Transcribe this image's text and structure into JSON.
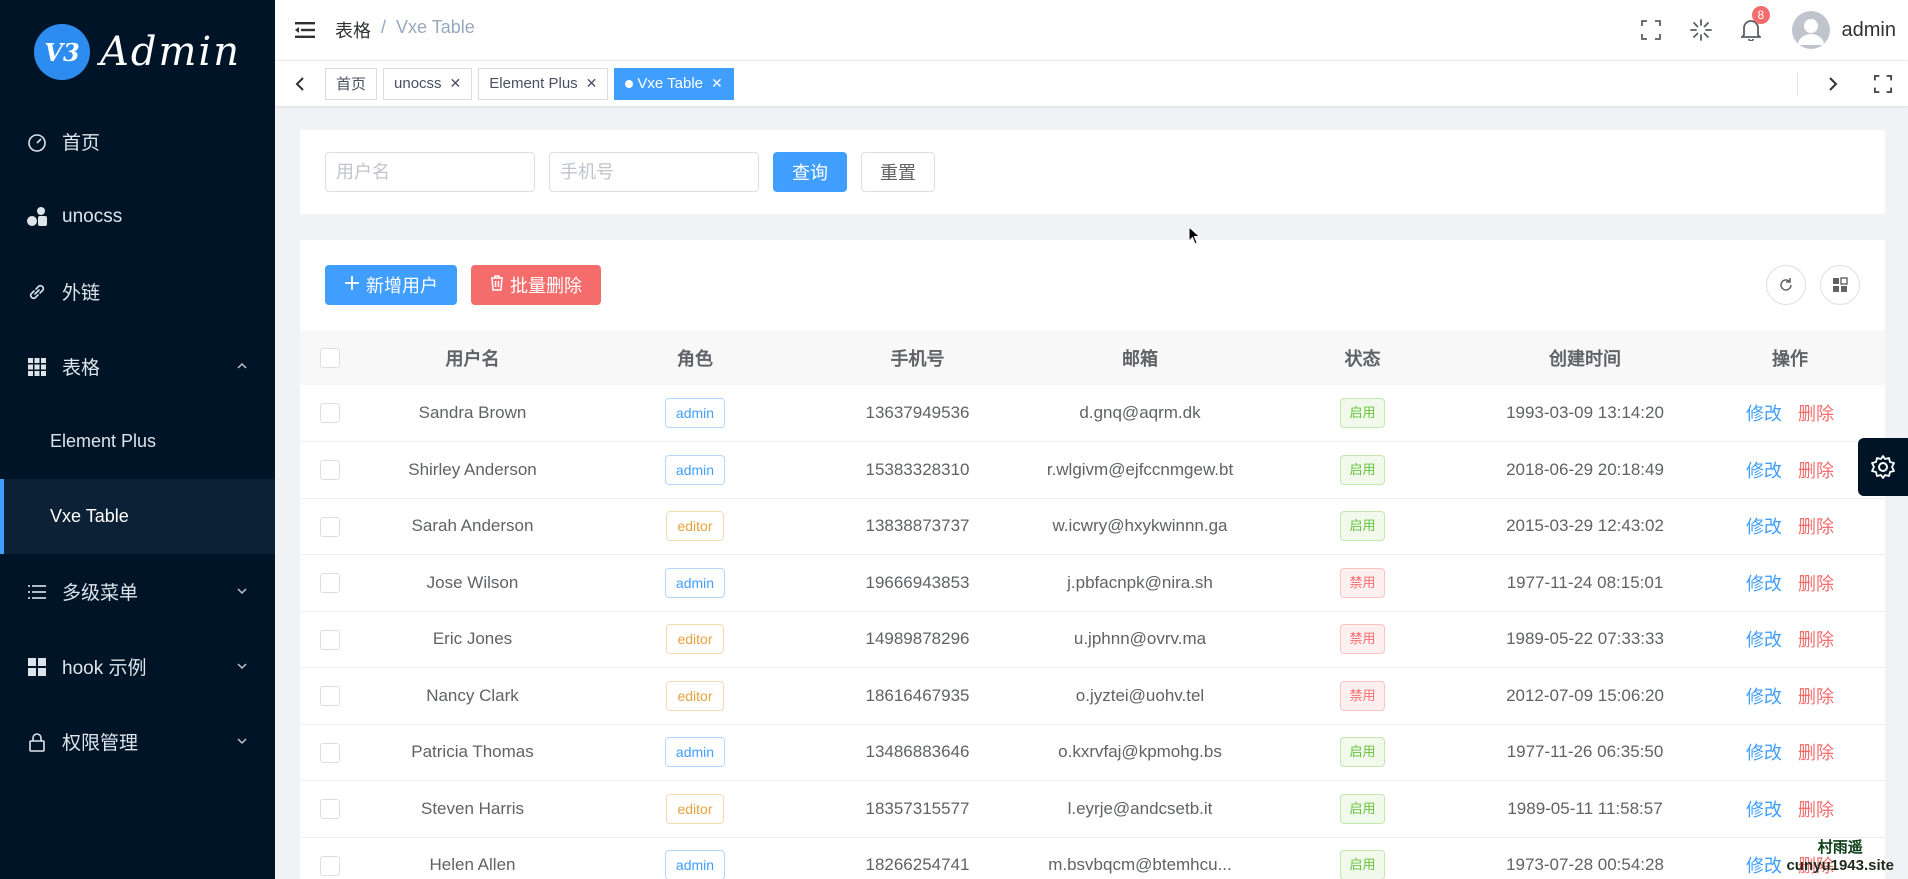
{
  "brand": {
    "badge": "V3",
    "name": "Admin"
  },
  "sidebar": {
    "items": [
      {
        "label": "首页",
        "icon": "dashboard-icon"
      },
      {
        "label": "unocss",
        "icon": "unocss-icon"
      },
      {
        "label": "外链",
        "icon": "link-icon"
      },
      {
        "label": "表格",
        "icon": "grid-icon",
        "expanded": true,
        "children": [
          {
            "label": "Element Plus"
          },
          {
            "label": "Vxe Table",
            "active": true
          }
        ]
      },
      {
        "label": "多级菜单",
        "icon": "menu-icon"
      },
      {
        "label": "hook 示例",
        "icon": "grid-icon"
      },
      {
        "label": "权限管理",
        "icon": "lock-icon"
      }
    ]
  },
  "header": {
    "breadcrumb": [
      "表格",
      "Vxe Table"
    ],
    "separator": "/",
    "notification_count": "8",
    "username": "admin"
  },
  "tags": [
    {
      "label": "首页",
      "closable": false,
      "active": false
    },
    {
      "label": "unocss",
      "closable": true,
      "active": false
    },
    {
      "label": "Element Plus",
      "closable": true,
      "active": false
    },
    {
      "label": "Vxe Table",
      "closable": true,
      "active": true
    }
  ],
  "search": {
    "username_placeholder": "用户名",
    "phone_placeholder": "手机号",
    "query_label": "查询",
    "reset_label": "重置"
  },
  "toolbar": {
    "add_label": "新增用户",
    "batch_delete_label": "批量删除"
  },
  "table": {
    "columns": [
      "用户名",
      "角色",
      "手机号",
      "邮箱",
      "状态",
      "创建时间",
      "操作"
    ],
    "edit_label": "修改",
    "delete_label": "删除",
    "rows": [
      {
        "username": "Sandra Brown",
        "role": "admin",
        "phone": "13637949536",
        "email": "d.gnq@aqrm.dk",
        "status": "启用",
        "created": "1993-03-09 13:14:20"
      },
      {
        "username": "Shirley Anderson",
        "role": "admin",
        "phone": "15383328310",
        "email": "r.wlgivm@ejfccnmgew.bt",
        "status": "启用",
        "created": "2018-06-29 20:18:49"
      },
      {
        "username": "Sarah Anderson",
        "role": "editor",
        "phone": "13838873737",
        "email": "w.icwry@hxykwinnn.ga",
        "status": "启用",
        "created": "2015-03-29 12:43:02"
      },
      {
        "username": "Jose Wilson",
        "role": "admin",
        "phone": "19666943853",
        "email": "j.pbfacnpk@nira.sh",
        "status": "禁用",
        "created": "1977-11-24 08:15:01"
      },
      {
        "username": "Eric Jones",
        "role": "editor",
        "phone": "14989878296",
        "email": "u.jphnn@ovrv.ma",
        "status": "禁用",
        "created": "1989-05-22 07:33:33"
      },
      {
        "username": "Nancy Clark",
        "role": "editor",
        "phone": "18616467935",
        "email": "o.jyztei@uohv.tel",
        "status": "禁用",
        "created": "2012-07-09 15:06:20"
      },
      {
        "username": "Patricia Thomas",
        "role": "admin",
        "phone": "13486883646",
        "email": "o.kxrvfaj@kpmohg.bs",
        "status": "启用",
        "created": "1977-11-26 06:35:50"
      },
      {
        "username": "Steven Harris",
        "role": "editor",
        "phone": "18357315577",
        "email": "l.eyrje@andcsetb.it",
        "status": "启用",
        "created": "1989-05-11 11:58:57"
      },
      {
        "username": "Helen Allen",
        "role": "admin",
        "phone": "18266254741",
        "email": "m.bsvbqcm@btemhcu...",
        "status": "启用",
        "created": "1973-07-28 00:54:28"
      }
    ]
  },
  "watermark": {
    "line1": "村雨遥",
    "line2": "cunyu1943.site"
  },
  "colors": {
    "sidebar_bg": "#001428",
    "primary": "#409eff",
    "danger": "#f56c6c",
    "success": "#67c23a",
    "warning": "#e6a23c"
  }
}
